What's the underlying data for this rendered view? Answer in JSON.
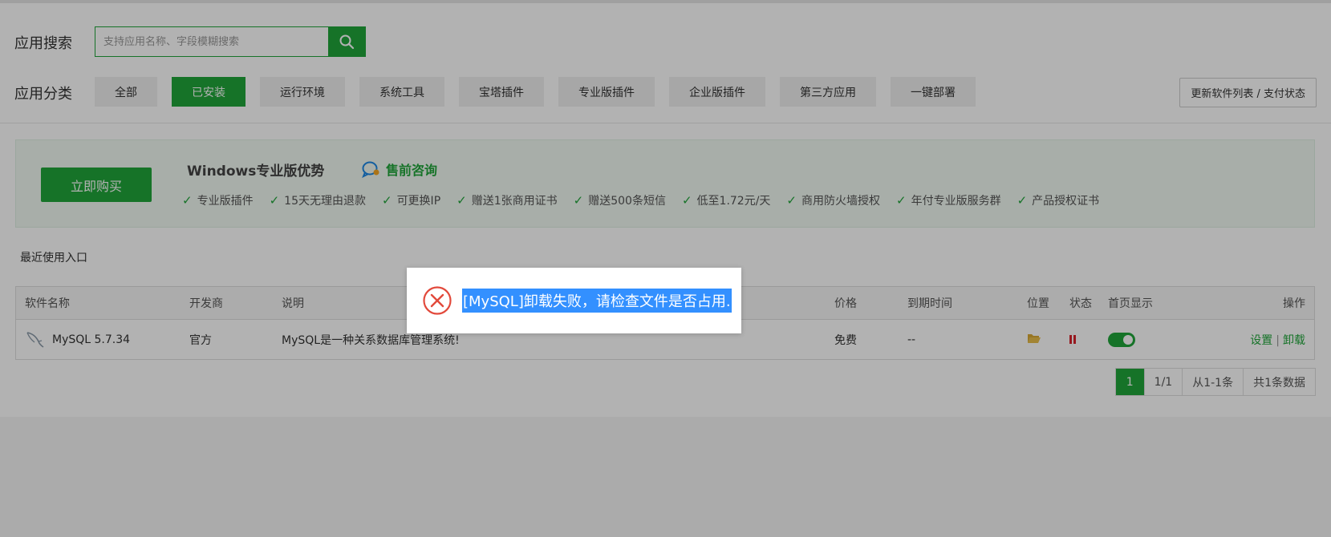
{
  "search": {
    "label": "应用搜索",
    "placeholder": "支持应用名称、字段模糊搜索",
    "value": ""
  },
  "categories": {
    "label": "应用分类",
    "items": [
      "全部",
      "已安装",
      "运行环境",
      "系统工具",
      "宝塔插件",
      "专业版插件",
      "企业版插件",
      "第三方应用",
      "一键部署"
    ],
    "active": "已安装"
  },
  "refresh_button": "更新软件列表 / 支付状态",
  "promo": {
    "buy_label": "立即购买",
    "title": "Windows专业版优势",
    "consult_label": "售前咨询",
    "features": [
      "专业版插件",
      "15天无理由退款",
      "可更换IP",
      "赠送1张商用证书",
      "赠送500条短信",
      "低至1.72元/天",
      "商用防火墙授权",
      "年付专业版服务群",
      "产品授权证书"
    ]
  },
  "recent_label": "最近使用入口",
  "table": {
    "headers": {
      "name": "软件名称",
      "developer": "开发商",
      "description": "说明",
      "price": "价格",
      "expire": "到期时间",
      "location": "位置",
      "status": "状态",
      "homepage": "首页显示",
      "ops": "操作"
    },
    "rows": [
      {
        "name": "MySQL 5.7.34",
        "developer": "官方",
        "description": "MySQL是一种关系数据库管理系统!",
        "price": "免费",
        "expire": "--",
        "op_settings": "设置",
        "op_separator": "|",
        "op_uninstall": "卸载"
      }
    ]
  },
  "pagination": {
    "current": "1",
    "pages": "1/1",
    "range": "从1-1条",
    "total": "共1条数据"
  },
  "dialog": {
    "message": "[MySQL]卸载失败，请检查文件是否占用."
  },
  "colors": {
    "accent": "#20a53a",
    "error": "#e2493b",
    "selection": "#3390ff"
  }
}
